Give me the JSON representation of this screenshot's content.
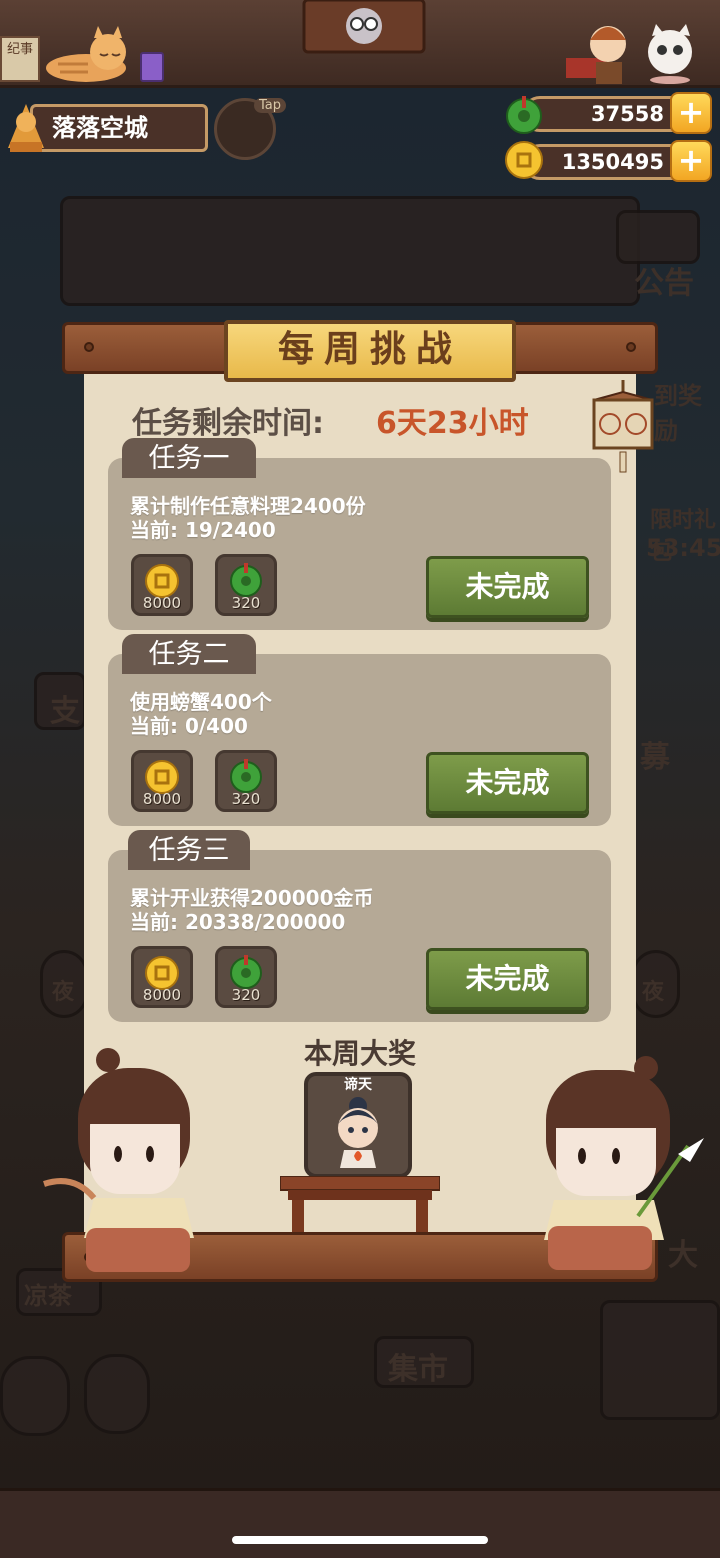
{
  "hud": {
    "player_name": "落落空城",
    "tap_label": "Tap",
    "jade": "37558",
    "coins": "1350495",
    "plus": "+"
  },
  "background_labels": {
    "notice": "公告",
    "top_left_sign": "纪事",
    "sign_in_reward": "到奖励",
    "limited_gift": "限时礼包",
    "countdown": "53:45",
    "market": "集市",
    "liangcha": "凉茶",
    "left_side": "支",
    "right_side": "募",
    "night_left": "夜",
    "night_right": "夜",
    "right_sign": "大"
  },
  "dialog": {
    "title": "每周挑战",
    "timer_label": "任务剩余时间:",
    "timer_value": "6天23小时",
    "tasks": [
      {
        "name": "任务一",
        "desc": "累计制作任意料理2400份",
        "progress": "当前: 19/2400",
        "reward_coin": "8000",
        "reward_jade": "320",
        "status": "未完成"
      },
      {
        "name": "任务二",
        "desc": "使用螃蟹400个",
        "progress": "当前: 0/400",
        "reward_coin": "8000",
        "reward_jade": "320",
        "status": "未完成"
      },
      {
        "name": "任务三",
        "desc": "累计开业获得200000金币",
        "progress": "当前: 20338/200000",
        "reward_coin": "8000",
        "reward_jade": "320",
        "status": "未完成"
      }
    ],
    "grand_prize_title": "本周大奖",
    "grand_prize_name": "谛天"
  },
  "colors": {
    "accent_orange": "#c8552a",
    "button_green": "#6d8b3f",
    "title_gold": "#f0c860"
  }
}
